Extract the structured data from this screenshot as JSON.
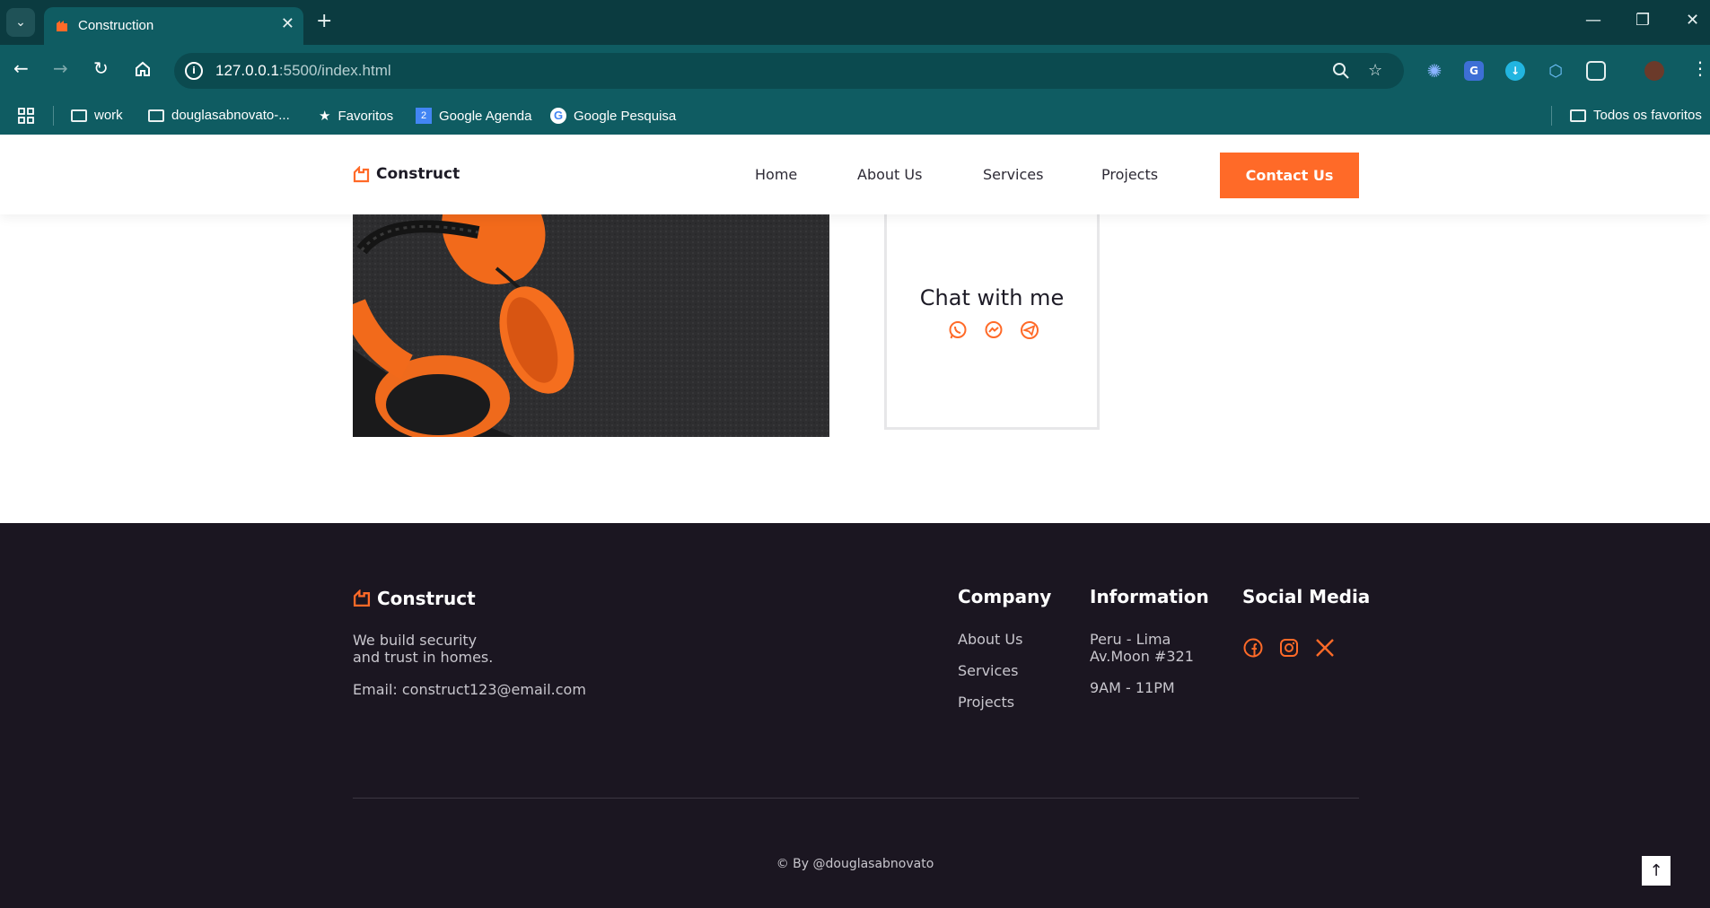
{
  "browser": {
    "tab_title": "Construction",
    "url_host": "127.0.0.1",
    "url_path": ":5500/index.html",
    "bookmarks": [
      {
        "label": "work",
        "icon": "folder-icon"
      },
      {
        "label": "douglasabnovato-...",
        "icon": "folder-icon"
      },
      {
        "label": "Favoritos",
        "icon": "star-icon"
      },
      {
        "label": "Google Agenda",
        "icon": "calendar-icon"
      },
      {
        "label": "Google Pesquisa",
        "icon": "google-icon"
      }
    ],
    "all_bookmarks": "Todos os favoritos"
  },
  "header": {
    "logo": "Construct",
    "nav": [
      "Home",
      "About Us",
      "Services",
      "Projects"
    ],
    "cta": "Contact Us"
  },
  "chat": {
    "title": "Chat with me",
    "icons": [
      "whatsapp-icon",
      "messenger-icon",
      "telegram-icon"
    ]
  },
  "footer": {
    "logo": "Construct",
    "tagline_1": "We build security",
    "tagline_2": "and trust in homes.",
    "email": "Email: construct123@email.com",
    "company": {
      "title": "Company",
      "links": [
        "About Us",
        "Services",
        "Projects"
      ]
    },
    "information": {
      "title": "Information",
      "address_1": "Peru - Lima",
      "address_2": "Av.Moon #321",
      "hours": "9AM - 11PM"
    },
    "social": {
      "title": "Social Media",
      "icons": [
        "facebook-icon",
        "instagram-icon",
        "x-icon"
      ]
    },
    "copyright": "© By @douglasabnovato"
  },
  "colors": {
    "accent": "#ff6a28",
    "footer_bg": "#1b1621",
    "chrome": "#0f5c62"
  }
}
